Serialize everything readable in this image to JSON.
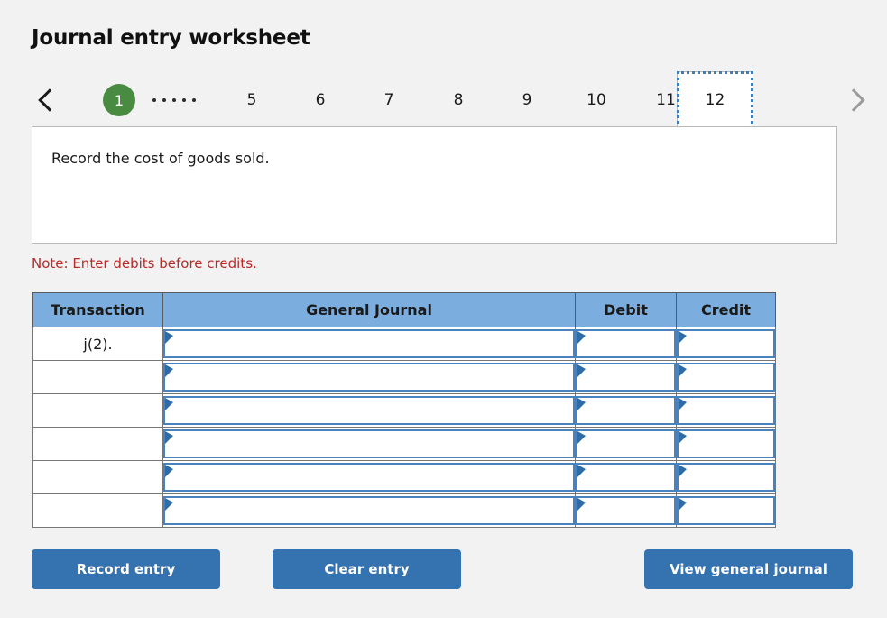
{
  "page": {
    "title": "Journal entry worksheet",
    "background_color": "#f2f2f2"
  },
  "step_nav": {
    "prev_icon": "chevron-left-icon",
    "next_icon": "chevron-right-icon",
    "ellipsis": ".....",
    "active_circle_color": "#4a8b42",
    "selected_outline_color": "#3f7cbf",
    "steps": [
      {
        "label": "1",
        "state": "completed"
      },
      {
        "label": "5",
        "state": "normal"
      },
      {
        "label": "6",
        "state": "normal"
      },
      {
        "label": "7",
        "state": "normal"
      },
      {
        "label": "8",
        "state": "normal"
      },
      {
        "label": "9",
        "state": "normal"
      },
      {
        "label": "10",
        "state": "normal"
      },
      {
        "label": "11",
        "state": "normal"
      },
      {
        "label": "12",
        "state": "selected"
      }
    ]
  },
  "description": {
    "text": "Record the cost of goods sold."
  },
  "note": {
    "text": "Note: Enter debits before credits.",
    "color": "#b52b29"
  },
  "table": {
    "header_color": "#7badde",
    "columns": [
      "Transaction",
      "General Journal",
      "Debit",
      "Credit"
    ],
    "rows": [
      {
        "transaction": "j(2).",
        "general_journal": "",
        "debit": "",
        "credit": ""
      },
      {
        "transaction": "",
        "general_journal": "",
        "debit": "",
        "credit": ""
      },
      {
        "transaction": "",
        "general_journal": "",
        "debit": "",
        "credit": ""
      },
      {
        "transaction": "",
        "general_journal": "",
        "debit": "",
        "credit": ""
      },
      {
        "transaction": "",
        "general_journal": "",
        "debit": "",
        "credit": ""
      },
      {
        "transaction": "",
        "general_journal": "",
        "debit": "",
        "credit": ""
      }
    ]
  },
  "buttons": {
    "color": "#3572b0",
    "record": "Record entry",
    "clear": "Clear entry",
    "view": "View general journal"
  }
}
